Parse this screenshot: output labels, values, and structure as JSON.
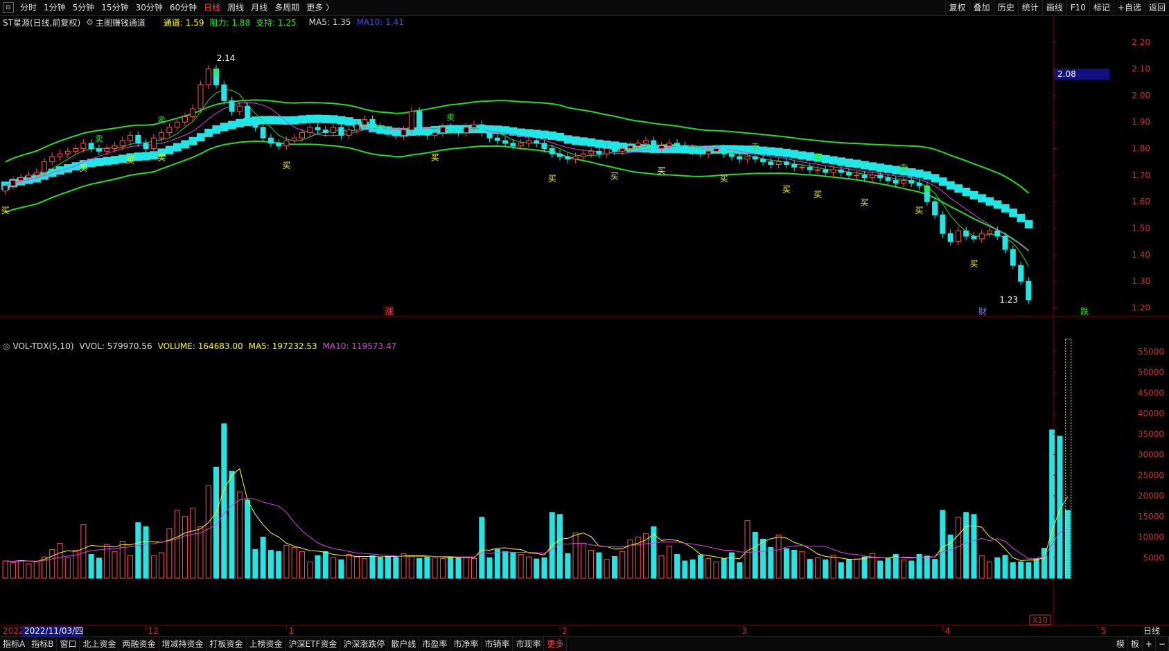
{
  "topbar": {
    "periods": [
      "分时",
      "1分钟",
      "5分钟",
      "15分钟",
      "30分钟",
      "60分钟",
      "日线",
      "周线",
      "月线",
      "多周期",
      "更多 〉"
    ],
    "active_period": "日线",
    "right_buttons": [
      "复权",
      "叠加",
      "历史",
      "统计",
      "画线",
      "F10",
      "标记",
      "+自选",
      "返回"
    ]
  },
  "info": {
    "stock": "ST星源(日线,前复权)",
    "indicator": "主图赚钱通道",
    "channel": "通道: 1.59",
    "resistance": "阻力: 1.88",
    "support": "支持: 1.25",
    "ma5": "MA5: 1.35",
    "ma10": "MA10: 1.41"
  },
  "vol_info": {
    "name": "VOL-TDX(5,10)",
    "vvol": "VVOL: 579970.56",
    "volume": "VOLUME: 164683.00",
    "ma5": "MA5: 197232.53",
    "ma10": "MA10: 119573.47"
  },
  "bottombar": {
    "tabs": [
      "指标A",
      "指标B",
      "窗口",
      "北上资金",
      "两融资金",
      "增减持资金",
      "打板资金",
      "上榜资金",
      "沪深ETF资金",
      "沪深涨跌停",
      "散户线",
      "市盈率",
      "市净率",
      "市销率",
      "市现率",
      "更多"
    ],
    "active_tab": "更多",
    "right": [
      "模",
      "板",
      "+",
      "−"
    ]
  },
  "dates": {
    "year_prefix": "2022",
    "cursor_date": "2022/11/03/四",
    "month_marks": [
      "12",
      "1",
      "2",
      "3",
      "4",
      "5"
    ],
    "right_label": "日线"
  },
  "colors": {
    "up": "#ff5050",
    "down": "#20e6e6",
    "green_line": "#22dd22",
    "ma5": "#ffff00",
    "ma10": "#e040e0",
    "axis": "#8b0000"
  },
  "chart_data": [
    {
      "type": "candlestick",
      "ylim": [
        1.17,
        2.25
      ],
      "y_ticks": [
        1.2,
        1.3,
        1.4,
        1.5,
        1.6,
        1.7,
        1.8,
        1.9,
        2.0,
        2.1,
        2.2
      ],
      "y_tick_labels": [
        "1.20",
        "1.30",
        "1.40",
        "1.50",
        "1.60",
        "1.70",
        "1.80",
        "1.90",
        "2.00",
        "2.10",
        "2.20"
      ],
      "current_price": "2.08",
      "high_label": "2.14",
      "low_label": "1.23",
      "markers": {
        "zhang": "涨",
        "cai": "财",
        "die": "跌"
      },
      "signal_buy": "买",
      "signal_sell": "卖",
      "closes": [
        1.66,
        1.68,
        1.69,
        1.7,
        1.71,
        1.75,
        1.77,
        1.78,
        1.79,
        1.8,
        1.82,
        1.8,
        1.79,
        1.8,
        1.81,
        1.83,
        1.85,
        1.82,
        1.8,
        1.84,
        1.86,
        1.88,
        1.9,
        1.92,
        1.95,
        2.04,
        2.1,
        2.04,
        1.98,
        1.94,
        1.96,
        1.9,
        1.88,
        1.84,
        1.82,
        1.81,
        1.83,
        1.84,
        1.86,
        1.88,
        1.87,
        1.86,
        1.88,
        1.85,
        1.87,
        1.89,
        1.91,
        1.88,
        1.87,
        1.86,
        1.85,
        1.87,
        1.94,
        1.86,
        1.85,
        1.86,
        1.88,
        1.87,
        1.86,
        1.88,
        1.89,
        1.86,
        1.84,
        1.83,
        1.82,
        1.81,
        1.82,
        1.83,
        1.82,
        1.8,
        1.78,
        1.77,
        1.76,
        1.77,
        1.78,
        1.79,
        1.78,
        1.8,
        1.79,
        1.8,
        1.81,
        1.82,
        1.83,
        1.8,
        1.81,
        1.82,
        1.81,
        1.8,
        1.79,
        1.78,
        1.79,
        1.8,
        1.78,
        1.77,
        1.76,
        1.77,
        1.76,
        1.75,
        1.74,
        1.75,
        1.74,
        1.73,
        1.73,
        1.72,
        1.72,
        1.71,
        1.72,
        1.71,
        1.7,
        1.7,
        1.69,
        1.7,
        1.69,
        1.68,
        1.67,
        1.68,
        1.67,
        1.66,
        1.6,
        1.55,
        1.48,
        1.45,
        1.49,
        1.47,
        1.46,
        1.48,
        1.49,
        1.47,
        1.42,
        1.36,
        1.3,
        1.23
      ]
    },
    {
      "type": "bar",
      "ylim": [
        0,
        60000
      ],
      "y_ticks": [
        5000,
        10000,
        15000,
        20000,
        25000,
        30000,
        35000,
        40000,
        45000,
        50000,
        55000
      ],
      "y_tick_labels": [
        "5000",
        "10000",
        "15000",
        "20000",
        "25000",
        "30000",
        "35000",
        "40000",
        "45000",
        "50000",
        "55000"
      ],
      "unit_label": "X10",
      "volumes": [
        4200,
        3800,
        4300,
        3500,
        4000,
        5200,
        7000,
        8500,
        5000,
        6800,
        13000,
        5800,
        4900,
        8200,
        6500,
        9000,
        5500,
        13500,
        12500,
        5500,
        6200,
        12000,
        16500,
        15000,
        17000,
        12500,
        22500,
        27000,
        37500,
        26000,
        21000,
        19000,
        7000,
        10000,
        6800,
        6500,
        8000,
        7500,
        6500,
        4000,
        5500,
        6500,
        5000,
        4500,
        5800,
        5200,
        4800,
        5500,
        5000,
        5300,
        5100,
        6000,
        5500,
        4800,
        5200,
        5000,
        4800,
        5100,
        4900,
        5200,
        4800,
        14800,
        5000,
        7000,
        6500,
        6300,
        5800,
        5200,
        4700,
        5000,
        16000,
        15500,
        6000,
        11000,
        8500,
        6800,
        6200,
        4600,
        5300,
        6500,
        9300,
        10000,
        10800,
        12500,
        5500,
        7800,
        5800,
        4200,
        4500,
        5600,
        4800,
        4000,
        4800,
        6200,
        3800,
        14000,
        11200,
        9500,
        7500,
        10500,
        7200,
        6800,
        6500,
        4600,
        5000,
        4500,
        5500,
        3800,
        4600,
        4700,
        5200,
        6000,
        4200,
        4800,
        5800,
        4500,
        4200,
        5800,
        5400,
        4600,
        16500,
        10500,
        14800,
        16000,
        15500,
        5500,
        4000,
        5000,
        5600,
        3800,
        4000,
        3800,
        4800,
        7300,
        36000,
        34500,
        16500
      ],
      "ma5": [
        4200,
        4100,
        4300,
        4200,
        4100,
        4600,
        5400,
        6200,
        6700,
        6500,
        7200,
        8000,
        7800,
        7700,
        7600,
        8200,
        8100,
        8600,
        9000,
        8900,
        8700,
        9300,
        10000,
        11000,
        11500,
        12000,
        13500,
        16000,
        21500,
        25000,
        26600,
        19000,
        15500,
        13000,
        11000,
        10000,
        8500,
        7800,
        7300,
        6700,
        6600,
        6300,
        5800,
        5600,
        5500,
        5300,
        5300,
        5300,
        5200,
        5300,
        5300,
        5400,
        5500,
        5500,
        5400,
        5300,
        5200,
        5100,
        5000,
        5000,
        5000,
        6900,
        6800,
        7300,
        7400,
        7100,
        7000,
        6200,
        6000,
        5700,
        7900,
        9500,
        9700,
        10500,
        11000,
        10100,
        7800,
        7700,
        7100,
        7200,
        8000,
        8500,
        9300,
        10700,
        9200,
        9400,
        9200,
        8500,
        7400,
        5800,
        5500,
        5200,
        4800,
        5000,
        4700,
        6700,
        7600,
        8800,
        9600,
        10000,
        9800,
        8700,
        8100,
        7200,
        5900,
        5300,
        5100,
        4900,
        4600,
        4600,
        4800,
        5100,
        5000,
        5000,
        5300,
        5000,
        4900,
        5000,
        5200,
        5200,
        7600,
        8500,
        10500,
        12600,
        12700,
        12400,
        10100,
        9000,
        7200,
        5000,
        4300,
        4400,
        4500,
        5000,
        11500,
        16700,
        19800
      ],
      "ma10": [
        4200,
        4100,
        4150,
        4200,
        4150,
        4300,
        4700,
        5100,
        5400,
        5600,
        6200,
        6700,
        6900,
        7100,
        7200,
        7500,
        7600,
        8000,
        8300,
        8400,
        8800,
        9100,
        9600,
        10300,
        10700,
        11000,
        12000,
        13000,
        15700,
        17700,
        19000,
        19500,
        19200,
        18500,
        18000,
        17500,
        16000,
        13500,
        11500,
        10000,
        8600,
        7800,
        7200,
        6900,
        6500,
        6100,
        6000,
        5900,
        5700,
        5600,
        5400,
        5300,
        5300,
        5300,
        5300,
        5300,
        5300,
        5300,
        5200,
        5200,
        5200,
        6200,
        6000,
        6300,
        6400,
        6300,
        6300,
        6300,
        6200,
        6100,
        7000,
        8300,
        8300,
        8500,
        8500,
        8100,
        7900,
        7700,
        7600,
        7600,
        8000,
        8100,
        8400,
        8500,
        8800,
        8800,
        8800,
        8500,
        8300,
        8000,
        7600,
        7200,
        6800,
        6800,
        6400,
        6300,
        6400,
        6500,
        6700,
        6900,
        7600,
        7800,
        8000,
        7700,
        7800,
        7700,
        7000,
        6300,
        5900,
        5800,
        5400,
        5200,
        5100,
        4900,
        5000,
        5200,
        5100,
        5000,
        5100,
        5200,
        6500,
        6800,
        7700,
        8600,
        9100,
        9700,
        9100,
        9600,
        9000,
        7300,
        6000,
        4700,
        4800,
        5300,
        8200,
        11200,
        11900
      ]
    }
  ]
}
